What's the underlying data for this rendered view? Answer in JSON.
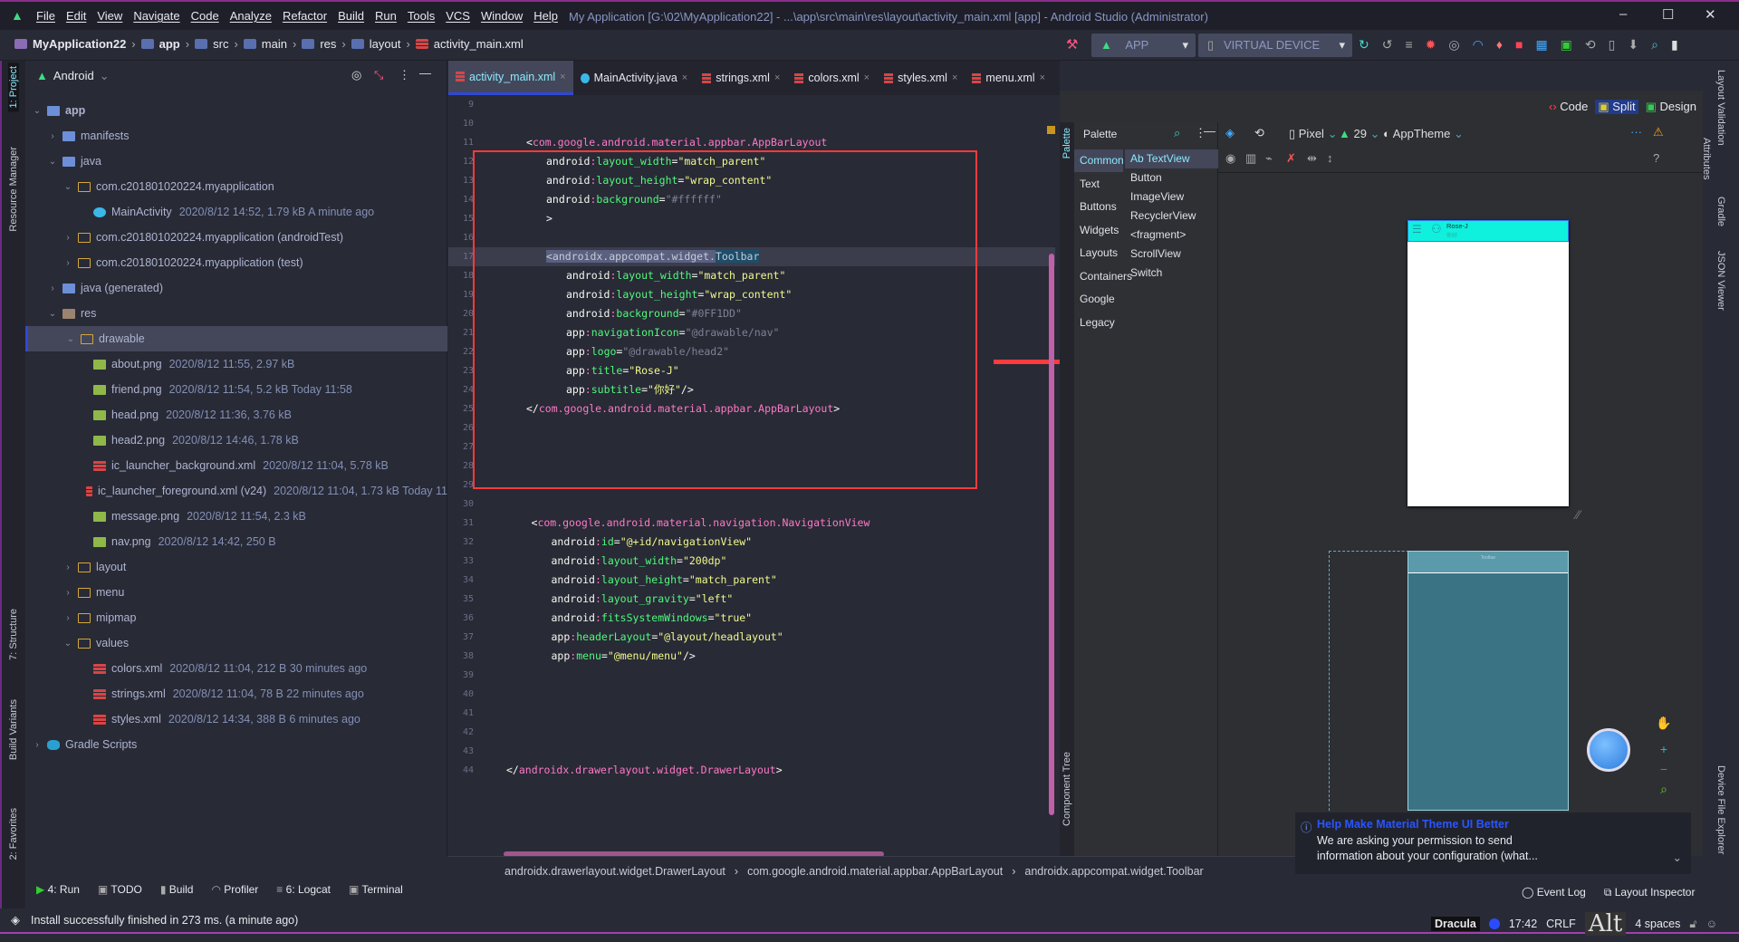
{
  "menu": [
    "File",
    "Edit",
    "View",
    "Navigate",
    "Code",
    "Analyze",
    "Refactor",
    "Build",
    "Run",
    "Tools",
    "VCS",
    "Window",
    "Help"
  ],
  "window_title": "My Application [G:\\02\\MyApplication22] - ...\\app\\src\\main\\res\\layout\\activity_main.xml [app] - Android Studio (Administrator)",
  "breadcrumb": [
    "MyApplication22",
    "app",
    "src",
    "main",
    "res",
    "layout",
    "activity_main.xml"
  ],
  "toolbar": {
    "run_config": "APP",
    "device": "VIRTUAL DEVICE"
  },
  "left_strip": {
    "project": "1: Project",
    "resource_manager": "Resource Manager",
    "structure": "7: Structure",
    "build_variants": "Build Variants",
    "favorites": "2: Favorites"
  },
  "project": {
    "view": "Android",
    "tree": [
      {
        "name": "app",
        "depth": 0,
        "arrow": "v",
        "icon": "folder",
        "meta": ""
      },
      {
        "name": "manifests",
        "depth": 1,
        "arrow": ">",
        "icon": "folder",
        "meta": ""
      },
      {
        "name": "java",
        "depth": 1,
        "arrow": "v",
        "icon": "folder",
        "meta": ""
      },
      {
        "name": "com.c201801020224.myapplication",
        "depth": 2,
        "arrow": "v",
        "icon": "pkg",
        "meta": ""
      },
      {
        "name": "MainActivity",
        "depth": 3,
        "arrow": "",
        "icon": "java",
        "meta": "2020/8/12 14:52, 1.79 kB  A minute ago"
      },
      {
        "name": "com.c201801020224.myapplication (androidTest)",
        "depth": 2,
        "arrow": ">",
        "icon": "pkg",
        "meta": ""
      },
      {
        "name": "com.c201801020224.myapplication (test)",
        "depth": 2,
        "arrow": ">",
        "icon": "pkg",
        "meta": ""
      },
      {
        "name": "java (generated)",
        "depth": 1,
        "arrow": ">",
        "icon": "folder",
        "meta": ""
      },
      {
        "name": "res",
        "depth": 1,
        "arrow": "v",
        "icon": "res",
        "meta": ""
      },
      {
        "name": "drawable",
        "depth": 2,
        "arrow": "v",
        "icon": "pkg",
        "meta": "",
        "selected": true
      },
      {
        "name": "about.png",
        "depth": 3,
        "arrow": "",
        "icon": "png",
        "meta": "2020/8/12 11:55, 2.97 kB"
      },
      {
        "name": "friend.png",
        "depth": 3,
        "arrow": "",
        "icon": "png",
        "meta": "2020/8/12 11:54, 5.2 kB  Today 11:58"
      },
      {
        "name": "head.png",
        "depth": 3,
        "arrow": "",
        "icon": "png",
        "meta": "2020/8/12 11:36, 3.76 kB"
      },
      {
        "name": "head2.png",
        "depth": 3,
        "arrow": "",
        "icon": "png",
        "meta": "2020/8/12 14:46, 1.78 kB"
      },
      {
        "name": "ic_launcher_background.xml",
        "depth": 3,
        "arrow": "",
        "icon": "xml",
        "meta": "2020/8/12 11:04, 5.78 kB"
      },
      {
        "name": "ic_launcher_foreground.xml (v24)",
        "depth": 3,
        "arrow": "",
        "icon": "xml",
        "meta": "2020/8/12 11:04, 1.73 kB  Today 11"
      },
      {
        "name": "message.png",
        "depth": 3,
        "arrow": "",
        "icon": "png",
        "meta": "2020/8/12 11:54, 2.3 kB"
      },
      {
        "name": "nav.png",
        "depth": 3,
        "arrow": "",
        "icon": "png",
        "meta": "2020/8/12 14:42, 250 B"
      },
      {
        "name": "layout",
        "depth": 2,
        "arrow": ">",
        "icon": "pkg",
        "meta": ""
      },
      {
        "name": "menu",
        "depth": 2,
        "arrow": ">",
        "icon": "pkg",
        "meta": ""
      },
      {
        "name": "mipmap",
        "depth": 2,
        "arrow": ">",
        "icon": "pkg",
        "meta": ""
      },
      {
        "name": "values",
        "depth": 2,
        "arrow": "v",
        "icon": "pkg",
        "meta": ""
      },
      {
        "name": "colors.xml",
        "depth": 3,
        "arrow": "",
        "icon": "xml",
        "meta": "2020/8/12 11:04, 212 B  30 minutes ago"
      },
      {
        "name": "strings.xml",
        "depth": 3,
        "arrow": "",
        "icon": "xml",
        "meta": "2020/8/12 11:04, 78 B  22 minutes ago"
      },
      {
        "name": "styles.xml",
        "depth": 3,
        "arrow": "",
        "icon": "xml",
        "meta": "2020/8/12 14:34, 388 B  6 minutes ago"
      },
      {
        "name": "Gradle Scripts",
        "depth": 0,
        "arrow": ">",
        "icon": "gradle",
        "meta": ""
      }
    ]
  },
  "tabs": [
    {
      "label": "activity_main.xml",
      "active": true,
      "type": "xml"
    },
    {
      "label": "MainActivity.java",
      "type": "java"
    },
    {
      "label": "strings.xml",
      "type": "xml"
    },
    {
      "label": "colors.xml",
      "type": "xml"
    },
    {
      "label": "styles.xml",
      "type": "xml"
    },
    {
      "label": "menu.xml",
      "type": "xml"
    }
  ],
  "code": [
    {
      "n": 9,
      "s": []
    },
    {
      "n": 10,
      "s": []
    },
    {
      "n": 11,
      "i": 1,
      "s": [
        [
          "p",
          "<"
        ],
        [
          "tag",
          "com.google.android.material.appbar.AppBarLayout"
        ]
      ]
    },
    {
      "n": 12,
      "i": 2,
      "s": [
        [
          "ns",
          "android"
        ],
        [
          "tag",
          ":"
        ],
        [
          "attr",
          "layout_width"
        ],
        [
          "p",
          "="
        ],
        [
          "val",
          "\"match_parent\""
        ]
      ]
    },
    {
      "n": 13,
      "i": 2,
      "s": [
        [
          "ns",
          "android"
        ],
        [
          "tag",
          ":"
        ],
        [
          "attr",
          "layout_height"
        ],
        [
          "p",
          "="
        ],
        [
          "val",
          "\"wrap_content\""
        ]
      ]
    },
    {
      "n": 14,
      "i": 2,
      "s": [
        [
          "ns",
          "android"
        ],
        [
          "tag",
          ":"
        ],
        [
          "attr",
          "background"
        ],
        [
          "p",
          "="
        ],
        [
          "dim",
          "\"#ffffff\""
        ]
      ]
    },
    {
      "n": 15,
      "i": 2,
      "s": [
        [
          "p",
          ">"
        ]
      ]
    },
    {
      "n": 16,
      "s": []
    },
    {
      "n": 17,
      "i": 2,
      "hl": true,
      "s": [
        [
          "sel",
          "<androidx.appcompat.widget."
        ],
        [
          "selb",
          "Toolbar"
        ]
      ]
    },
    {
      "n": 18,
      "i": 3,
      "s": [
        [
          "ns",
          "android"
        ],
        [
          "tag",
          ":"
        ],
        [
          "attr",
          "layout_width"
        ],
        [
          "p",
          "="
        ],
        [
          "val",
          "\"match_parent\""
        ]
      ]
    },
    {
      "n": 19,
      "i": 3,
      "s": [
        [
          "ns",
          "android"
        ],
        [
          "tag",
          ":"
        ],
        [
          "attr",
          "layout_height"
        ],
        [
          "p",
          "="
        ],
        [
          "val",
          "\"wrap_content\""
        ]
      ]
    },
    {
      "n": 20,
      "i": 3,
      "s": [
        [
          "ns",
          "android"
        ],
        [
          "tag",
          ":"
        ],
        [
          "attr",
          "background"
        ],
        [
          "p",
          "="
        ],
        [
          "dim",
          "\"#0FF1DD\""
        ]
      ]
    },
    {
      "n": 21,
      "i": 3,
      "s": [
        [
          "ns",
          "app"
        ],
        [
          "tag",
          ":"
        ],
        [
          "attr",
          "navigationIcon"
        ],
        [
          "p",
          "="
        ],
        [
          "dim",
          "\"@drawable/nav\""
        ]
      ]
    },
    {
      "n": 22,
      "i": 3,
      "s": [
        [
          "ns",
          "app"
        ],
        [
          "tag",
          ":"
        ],
        [
          "attr",
          "logo"
        ],
        [
          "p",
          "="
        ],
        [
          "dim",
          "\"@drawable/head2\""
        ]
      ]
    },
    {
      "n": 23,
      "i": 3,
      "s": [
        [
          "ns",
          "app"
        ],
        [
          "tag",
          ":"
        ],
        [
          "attr",
          "title"
        ],
        [
          "p",
          "="
        ],
        [
          "val",
          "\"Rose-J\""
        ]
      ]
    },
    {
      "n": 24,
      "i": 3,
      "s": [
        [
          "ns",
          "app"
        ],
        [
          "tag",
          ":"
        ],
        [
          "attr",
          "subtitle"
        ],
        [
          "p",
          "="
        ],
        [
          "val",
          "\"你好\""
        ],
        [
          "p",
          "/>"
        ]
      ]
    },
    {
      "n": 25,
      "i": 1,
      "s": [
        [
          "p",
          "</"
        ],
        [
          "tag",
          "com.google.android.material.appbar.AppBarLayout"
        ],
        [
          "p",
          ">"
        ]
      ]
    },
    {
      "n": 26,
      "s": []
    },
    {
      "n": 27,
      "s": []
    },
    {
      "n": 28,
      "s": []
    },
    {
      "n": 29,
      "s": []
    },
    {
      "n": 30,
      "s": []
    },
    {
      "n": 31,
      "i": 1.25,
      "s": [
        [
          "p",
          "<"
        ],
        [
          "tag",
          "com.google.android.material.navigation.NavigationView"
        ]
      ]
    },
    {
      "n": 32,
      "i": 2.25,
      "s": [
        [
          "ns",
          "android"
        ],
        [
          "tag",
          ":"
        ],
        [
          "attr",
          "id"
        ],
        [
          "p",
          "="
        ],
        [
          "val",
          "\"@+id/navigationView\""
        ]
      ]
    },
    {
      "n": 33,
      "i": 2.25,
      "s": [
        [
          "ns",
          "android"
        ],
        [
          "tag",
          ":"
        ],
        [
          "attr",
          "layout_width"
        ],
        [
          "p",
          "="
        ],
        [
          "val",
          "\"200dp\""
        ]
      ]
    },
    {
      "n": 34,
      "i": 2.25,
      "s": [
        [
          "ns",
          "android"
        ],
        [
          "tag",
          ":"
        ],
        [
          "attr",
          "layout_height"
        ],
        [
          "p",
          "="
        ],
        [
          "val",
          "\"match_parent\""
        ]
      ]
    },
    {
      "n": 35,
      "i": 2.25,
      "s": [
        [
          "ns",
          "android"
        ],
        [
          "tag",
          ":"
        ],
        [
          "attr",
          "layout_gravity"
        ],
        [
          "p",
          "="
        ],
        [
          "val",
          "\"left\""
        ]
      ]
    },
    {
      "n": 36,
      "i": 2.25,
      "s": [
        [
          "ns",
          "android"
        ],
        [
          "tag",
          ":"
        ],
        [
          "attr",
          "fitsSystemWindows"
        ],
        [
          "p",
          "="
        ],
        [
          "val",
          "\"true\""
        ]
      ]
    },
    {
      "n": 37,
      "i": 2.25,
      "s": [
        [
          "ns",
          "app"
        ],
        [
          "tag",
          ":"
        ],
        [
          "attr",
          "headerLayout"
        ],
        [
          "p",
          "="
        ],
        [
          "val",
          "\"@layout/headlayout\""
        ]
      ]
    },
    {
      "n": 38,
      "i": 2.25,
      "s": [
        [
          "ns",
          "app"
        ],
        [
          "tag",
          ":"
        ],
        [
          "attr",
          "menu"
        ],
        [
          "p",
          "="
        ],
        [
          "val",
          "\"@menu/menu\""
        ],
        [
          "p",
          "/>"
        ]
      ]
    },
    {
      "n": 39,
      "s": []
    },
    {
      "n": 40,
      "s": []
    },
    {
      "n": 41,
      "s": []
    },
    {
      "n": 42,
      "s": []
    },
    {
      "n": 43,
      "s": []
    },
    {
      "n": 44,
      "i": 0,
      "s": [
        [
          "p",
          "</"
        ],
        [
          "tag",
          "androidx.drawerlayout.widget.DrawerLayout"
        ],
        [
          "p",
          ">"
        ]
      ]
    }
  ],
  "editor_breadcrumb": [
    "androidx.drawerlayout.widget.DrawerLayout",
    "com.google.android.material.appbar.AppBarLayout",
    "androidx.appcompat.widget.Toolbar"
  ],
  "view_modes": {
    "code": "Code",
    "split": "Split",
    "design": "Design",
    "active": "Split"
  },
  "palette": {
    "title": "Palette",
    "categories": [
      "Common",
      "Text",
      "Buttons",
      "Widgets",
      "Layouts",
      "Containers",
      "Google",
      "Legacy"
    ],
    "items": [
      "Ab TextView",
      "Button",
      "ImageView",
      "RecyclerView",
      "<fragment>",
      "ScrollView",
      "Switch"
    ],
    "selected_category": "Common"
  },
  "design_toolbar": {
    "device": "Pixel",
    "api": "29",
    "theme": "AppTheme"
  },
  "preview": {
    "toolbar_title": "Rose-J",
    "toolbar_subtitle": "你好",
    "toolbar_color": "#0FF1DD",
    "blueprint_label": "Toolbar"
  },
  "side_tools": {
    "palette": "Palette",
    "component_tree": "Component Tree",
    "layout_validation": "Layout Validation",
    "attributes": "Attributes",
    "gradle": "Gradle",
    "json_viewer": "JSON Viewer",
    "device_file_explorer": "Device File Explorer"
  },
  "notification": {
    "title": "Help Make Material Theme UI Better",
    "body": "We are asking your permission to send information about your configuration (what..."
  },
  "bottom_tabs": [
    "4: Run",
    "TODO",
    "Build",
    "Profiler",
    "6: Logcat",
    "Terminal"
  ],
  "bottom_right": {
    "event_log": "Event Log",
    "layout_inspector": "Layout Inspector"
  },
  "status": {
    "message": "Install successfully finished in 273 ms. (a minute ago)",
    "theme": "Dracula",
    "position": "17:42",
    "line_sep": "CRLF",
    "indent": "4 spaces",
    "key_overlay": "Alt"
  }
}
